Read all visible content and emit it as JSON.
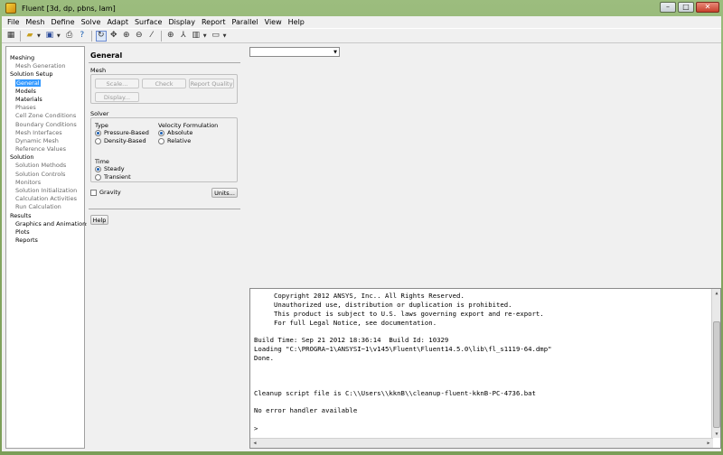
{
  "window": {
    "title": "Fluent  [3d, dp, pbns, lam]",
    "controls": {
      "minimize": "–",
      "maximize": "□",
      "close": "✕"
    }
  },
  "menubar": [
    "File",
    "Mesh",
    "Define",
    "Solve",
    "Adapt",
    "Surface",
    "Display",
    "Report",
    "Parallel",
    "View",
    "Help"
  ],
  "toolbar": {
    "icons": [
      "file-read-icon",
      "open-folder-icon",
      "save-icon",
      "print-icon",
      "help-icon",
      "rotate-icon",
      "pan-icon",
      "zoom-in-icon",
      "zoom-box-icon",
      "probe-icon",
      "fit-icon",
      "axes-icon",
      "mesh-display-icon",
      "layout-icon"
    ]
  },
  "nav": {
    "sections": [
      {
        "label": "Meshing",
        "items": [
          {
            "label": "Mesh Generation",
            "dark": false
          }
        ]
      },
      {
        "label": "Solution Setup",
        "items": [
          {
            "label": "General",
            "dark": true,
            "selected": true
          },
          {
            "label": "Models",
            "dark": true
          },
          {
            "label": "Materials",
            "dark": true
          },
          {
            "label": "Phases",
            "dark": false
          },
          {
            "label": "Cell Zone Conditions",
            "dark": false
          },
          {
            "label": "Boundary Conditions",
            "dark": false
          },
          {
            "label": "Mesh Interfaces",
            "dark": false
          },
          {
            "label": "Dynamic Mesh",
            "dark": false
          },
          {
            "label": "Reference Values",
            "dark": false
          }
        ]
      },
      {
        "label": "Solution",
        "items": [
          {
            "label": "Solution Methods",
            "dark": false
          },
          {
            "label": "Solution Controls",
            "dark": false
          },
          {
            "label": "Monitors",
            "dark": false
          },
          {
            "label": "Solution Initialization",
            "dark": false
          },
          {
            "label": "Calculation Activities",
            "dark": false
          },
          {
            "label": "Run Calculation",
            "dark": false
          }
        ]
      },
      {
        "label": "Results",
        "items": [
          {
            "label": "Graphics and Animations",
            "dark": true
          },
          {
            "label": "Plots",
            "dark": true
          },
          {
            "label": "Reports",
            "dark": true
          }
        ]
      }
    ]
  },
  "general": {
    "title": "General",
    "mesh": {
      "label": "Mesh",
      "scale": "Scale...",
      "check": "Check",
      "report_quality": "Report Quality",
      "display": "Display..."
    },
    "solver": {
      "label": "Solver",
      "type_label": "Type",
      "type_options": [
        "Pressure-Based",
        "Density-Based"
      ],
      "type_selected": "Pressure-Based",
      "velocity_label": "Velocity Formulation",
      "velocity_options": [
        "Absolute",
        "Relative"
      ],
      "velocity_selected": "Absolute",
      "time_label": "Time",
      "time_options": [
        "Steady",
        "Transient"
      ],
      "time_selected": "Steady"
    },
    "gravity_label": "Gravity",
    "units_button": "Units...",
    "help_button": "Help"
  },
  "console": {
    "lines": [
      "     Copyright 2012 ANSYS, Inc.. All Rights Reserved.",
      "     Unauthorized use, distribution or duplication is prohibited.",
      "     This product is subject to U.S. laws governing export and re-export.",
      "     For full Legal Notice, see documentation.",
      "",
      "Build Time: Sep 21 2012 18:36:14  Build Id: 10329",
      "Loading \"C:\\PROGRA~1\\ANSYSI~1\\v145\\Fluent\\Fluent14.5.0\\lib\\fl_s1119-64.dmp\"",
      "Done.",
      "",
      "",
      "",
      "Cleanup script file is C:\\\\Users\\\\kknB\\\\cleanup-fluent-kknB-PC-4736.bat",
      "",
      "No error handler available",
      "",
      ">"
    ]
  }
}
